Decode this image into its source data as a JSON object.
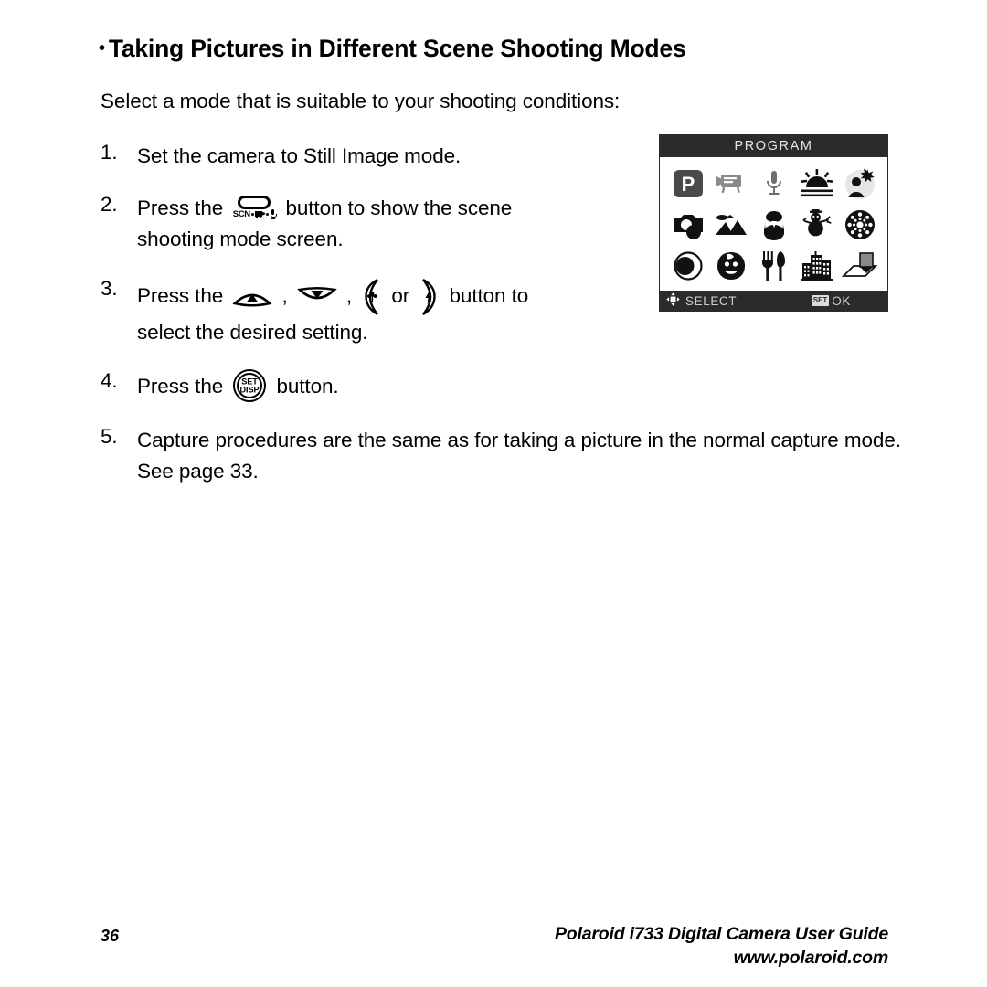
{
  "heading": {
    "bullet": "•",
    "text": "Taking Pictures in Different Scene Shooting Modes"
  },
  "intro": "Select a mode that is suitable to your shooting conditions:",
  "steps": [
    {
      "num": "1.",
      "text": "Set the camera to Still Image mode."
    },
    {
      "num": "2.",
      "before": "Press the ",
      "icon": "scn-video-mic-button-icon",
      "after": " button to show the scene",
      "line2": "shooting mode screen."
    },
    {
      "num": "3.",
      "before": "Press the ",
      "sep1": " , ",
      "sep2": " , ",
      "or": " or ",
      "after": " button to",
      "line2": "select the desired setting."
    },
    {
      "num": "4.",
      "before": "Press the ",
      "after": " button."
    },
    {
      "num": "5.",
      "text": "Capture procedures are the same as for taking a picture in the normal capture mode. See page 33."
    }
  ],
  "lcd": {
    "title": "PROGRAM",
    "selected_index": 0,
    "icons": [
      "program-mode-icon",
      "video-clip-mode-icon",
      "voice-record-mode-icon",
      "sunset-mode-icon",
      "portrait-backlight-mode-icon",
      "sport-mode-icon",
      "landscape-mode-icon",
      "night-portrait-mode-icon",
      "snow-mode-icon",
      "fireworks-mode-icon",
      "night-scene-mode-icon",
      "kids-mode-icon",
      "food-mode-icon",
      "building-mode-icon",
      "text-mode-icon"
    ],
    "program_letter": "P",
    "bar": {
      "select_label": "SELECT",
      "set_badge": "SET",
      "ok_label": "OK"
    }
  },
  "footer": {
    "page_number": "36",
    "guide_title": "Polaroid i733 Digital Camera User Guide",
    "website": "www.polaroid.com"
  },
  "colors": {
    "lcd_chrome": "#2b2b2b",
    "lcd_background": "#ffffff",
    "selected_tile": "#4a4a4a",
    "text": "#000000"
  }
}
